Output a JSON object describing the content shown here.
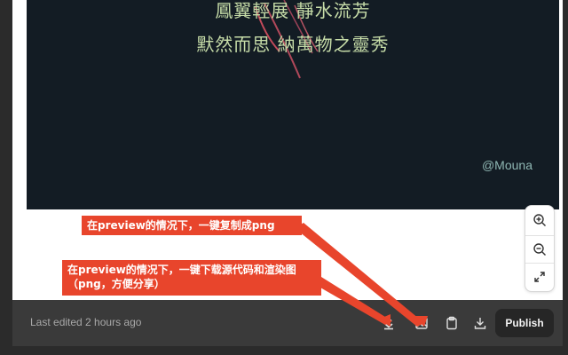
{
  "preview": {
    "poem_line_1": "鳳翼輕展 靜水流芳",
    "poem_line_2": "默然而思 納萬物之靈秀",
    "watermark": "@Mouna"
  },
  "zoom_controls": {
    "zoom_in_icon": "zoom-in-icon",
    "zoom_out_icon": "zoom-out-icon",
    "fullscreen_icon": "expand-icon"
  },
  "bottom_bar": {
    "last_edited": "Last edited 2 hours ago",
    "publish_label": "Publish",
    "tools": [
      "download-code-icon",
      "copy-image-icon",
      "clipboard-icon",
      "download-icon"
    ]
  },
  "annotations": {
    "copy_png": "在preview的情况下，一键复制成png",
    "download_source": "在preview的情况下，一键下载源代码和渲染图（png，方便分享）"
  },
  "colors": {
    "accent_annotation": "#e8452c",
    "preview_bg": "#131c24",
    "poem_text": "#c6dca8",
    "bottom_bar": "#3a3a3a"
  }
}
